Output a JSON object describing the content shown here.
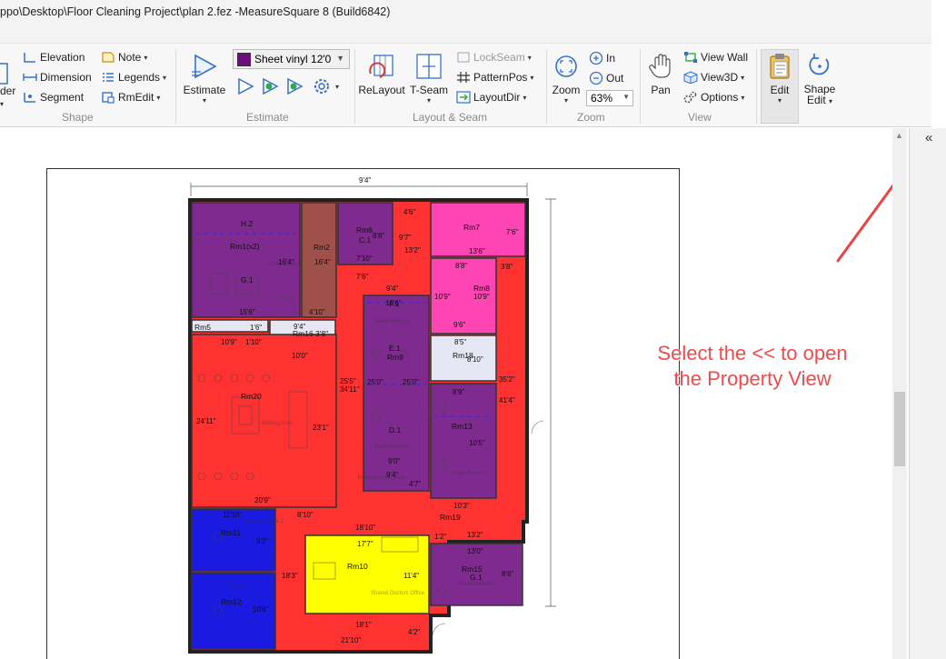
{
  "window": {
    "title": "ppo\\Desktop\\Floor Cleaning Project\\plan 2.fez -MeasureSquare 8 (Build6842)"
  },
  "ribbon": {
    "shape": {
      "group_label": "Shape",
      "cut_label": "der",
      "elevation": "Elevation",
      "dimension": "Dimension",
      "segment": "Segment",
      "note": "Note",
      "legends": "Legends",
      "rmedit": "RmEdit"
    },
    "estimate": {
      "group_label": "Estimate",
      "product_selected": "Sheet vinyl 12'0",
      "product_color": "#6b0f7a",
      "estimate_label": "Estimate"
    },
    "layout": {
      "group_label": "Layout & Seam",
      "relayout": "ReLayout",
      "tseam": "T-Seam",
      "lockseam": "LockSeam",
      "patternpos": "PatternPos",
      "layoutdir": "LayoutDir"
    },
    "zoom": {
      "group_label": "Zoom",
      "zoom": "Zoom",
      "in": "In",
      "out": "Out",
      "level": "63%"
    },
    "view": {
      "group_label": "View",
      "pan": "Pan",
      "viewwall": "View Wall",
      "view3d": "View3D",
      "options": "Options"
    },
    "edit": {
      "label": "Edit"
    },
    "shape_edit": {
      "label_line1": "Shape",
      "label_line2": "Edit"
    }
  },
  "property_toggle": "«",
  "callout": {
    "line1": "Select the << to open",
    "line2": "the Property View"
  },
  "colors": {
    "purple": "#7e2a8e",
    "red": "#ff3232",
    "pink": "#ff44b4",
    "blue": "#1a1ae0",
    "yellow": "#ffff00",
    "brown": "#a0504a",
    "light": "#e7e7f4",
    "accent_red": "#e84545"
  },
  "plan": {
    "overall_top": "9'4\"",
    "rooms": [
      {
        "label": "Rm1(x2)"
      },
      {
        "label": "H.2"
      },
      {
        "label": "G.1"
      },
      {
        "label": "Rm2"
      },
      {
        "label": "Rm6"
      },
      {
        "label": "C.1"
      },
      {
        "label": "Rm7"
      },
      {
        "label": "Rm8"
      },
      {
        "label": "Rm16 3'8\""
      },
      {
        "label": "Rm9"
      },
      {
        "label": "E.1"
      },
      {
        "label": "F.1"
      },
      {
        "label": "D.1"
      },
      {
        "label": "Rm18"
      },
      {
        "label": "Rm13"
      },
      {
        "label": "Rm20"
      },
      {
        "label": "Rm19"
      },
      {
        "label": "Rm11"
      },
      {
        "label": "Rm12"
      },
      {
        "label": "Rm10"
      },
      {
        "label": "Rm15"
      },
      {
        "label": "G.1"
      },
      {
        "label": "Rm5"
      }
    ],
    "dims": [
      "16'4\"",
      "15'6\"",
      "16'4\"",
      "4'10\"",
      "8'8\"",
      "7'10\"",
      "4'6\"",
      "9'7\"",
      "13'2\"",
      "7'6\"",
      "13'6\"",
      "8'8\"",
      "3'8\"",
      "10'9\"",
      "10'9\"",
      "9'6\"",
      "7'6\"",
      "9'4\"",
      "16'6\"",
      "1'6\"",
      "9'4\"",
      "10'9\"",
      "1'10\"",
      "10'0\"",
      "8'5\"",
      "8'10\"",
      "25'5\"",
      "34'11\"",
      "25'0\"",
      "25'0\"",
      "35'2\"",
      "41'4\"",
      "8'9\"",
      "24'11\"",
      "23'1\"",
      "10'5\"",
      "9'0\"",
      "9'4\"",
      "4'7\"",
      "20'9\"",
      "10'3\"",
      "8'10\"",
      "11'10\"",
      "9'2\"",
      "18'10\"",
      "1'2\"",
      "13'2\"",
      "17'7\"",
      "13'0\"",
      "11'4\"",
      "8'6\"",
      "18'3\"",
      "10'6\"",
      "18'1\"",
      "4'2\"",
      "21'10\""
    ],
    "text_areas": [
      "Nurse Station",
      "Exam Room 2",
      "Exam Room 4",
      "Waiting Area",
      "Waiting/Weigh Area",
      "Doctor's Office 1",
      "Office 2",
      "Shared Doctors Office",
      "Lockbed Room",
      "Exam Room 6"
    ]
  }
}
